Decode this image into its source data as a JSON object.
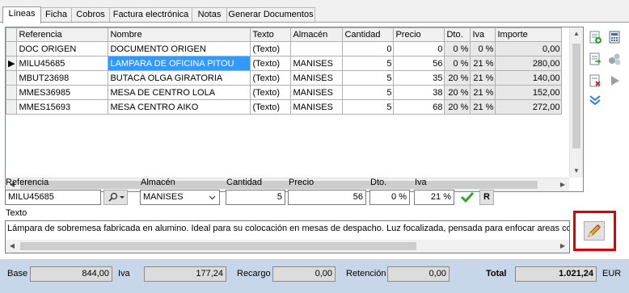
{
  "tabs": [
    "Líneas",
    "Ficha",
    "Cobros",
    "Factura electrónica",
    "Notas",
    "Generar Documentos"
  ],
  "grid": {
    "columns": [
      "Referencia",
      "Nombre",
      "Texto",
      "Almacén",
      "Cantidad",
      "Precio",
      "Dto.",
      "Iva",
      "Importe"
    ],
    "rows": [
      {
        "ref": "DOC ORIGEN",
        "nombre": "DOCUMENTO ORIGEN",
        "texto": "(Texto)",
        "almacen": "",
        "cantidad": "0",
        "precio": "0",
        "dto": "0 %",
        "iva": "0 %",
        "importe": "0,00",
        "current": false
      },
      {
        "ref": "MILU45685",
        "nombre": "LAMPARA DE OFICINA PITOU",
        "texto": "(Texto)",
        "almacen": "MANISES",
        "cantidad": "5",
        "precio": "56",
        "dto": "0 %",
        "iva": "21 %",
        "importe": "280,00",
        "current": true
      },
      {
        "ref": "MBUT23698",
        "nombre": "BUTACA OLGA GIRATORIA",
        "texto": "(Texto)",
        "almacen": "MANISES",
        "cantidad": "5",
        "precio": "35",
        "dto": "20 %",
        "iva": "21 %",
        "importe": "140,00",
        "current": false
      },
      {
        "ref": "MMES36985",
        "nombre": "MESA DE CENTRO LOLA",
        "texto": "(Texto)",
        "almacen": "MANISES",
        "cantidad": "5",
        "precio": "38",
        "dto": "20 %",
        "iva": "21 %",
        "importe": "152,00",
        "current": false
      },
      {
        "ref": "MMES15693",
        "nombre": "MESA CENTRO AIKO",
        "texto": "(Texto)",
        "almacen": "MANISES",
        "cantidad": "5",
        "precio": "68",
        "dto": "20 %",
        "iva": "21 %",
        "importe": "272,00",
        "current": false
      }
    ]
  },
  "form": {
    "referencia_label": "Referencia",
    "referencia": "MILU45685",
    "almacen_label": "Almacén",
    "almacen": "MANISES",
    "cantidad_label": "Cantidad",
    "cantidad": "5",
    "precio_label": "Precio",
    "precio": "56",
    "dto_label": "Dto.",
    "dto": "0 %",
    "iva_label": "Iva",
    "iva": "21 %",
    "r_button": "R",
    "texto_label": "Texto",
    "texto": "Lámpara de sobremesa fabricada en alumino. Ideal para su colocación en mesas de despacho. Luz focalizada, pensada para enfocar areas concre"
  },
  "footer": {
    "base_label": "Base",
    "base": "844,00",
    "iva_label": "Iva",
    "iva": "177,24",
    "recargo_label": "Recargo",
    "recargo": "0,00",
    "retencion_label": "Retención",
    "retencion": "0,00",
    "total_label": "Total",
    "total": "1.021,24",
    "currency": "EUR"
  },
  "colors": {
    "selection": "#3399ff",
    "footer": "#c7d6e8",
    "highlight_box": "#e00000"
  }
}
